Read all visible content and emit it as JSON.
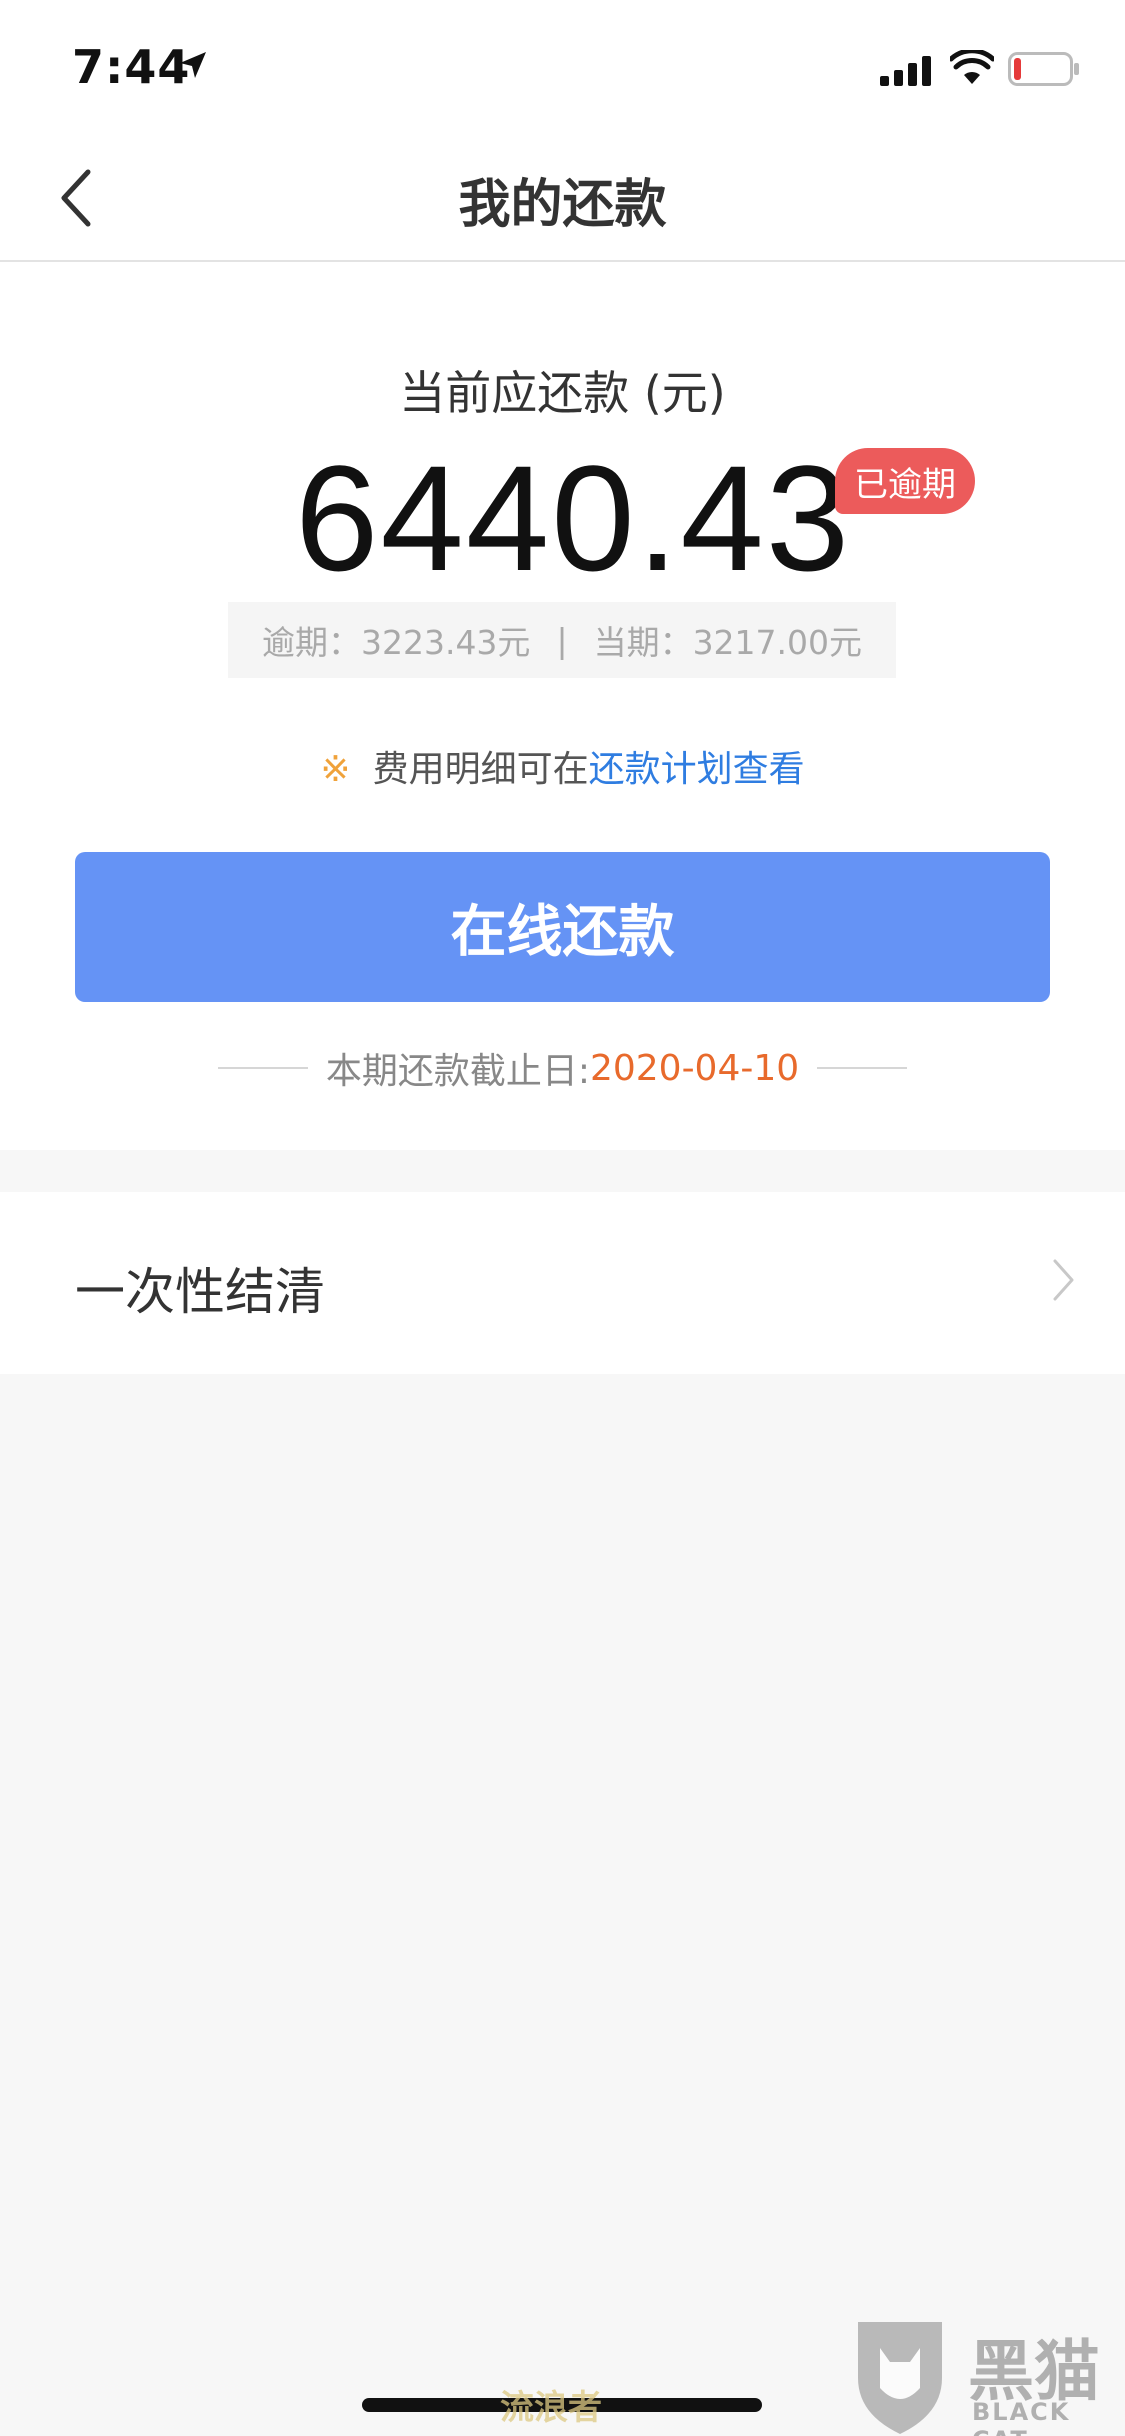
{
  "status_bar": {
    "time": "7:44"
  },
  "nav": {
    "title": "我的还款"
  },
  "summary": {
    "label": "当前应还款 (元)",
    "amount": "6440.43",
    "badge": "已逾期",
    "overdue_label": "逾期：",
    "overdue_amount": "3223.43元",
    "separator": "|",
    "current_label": "当期：",
    "current_amount": "3217.00元",
    "note_prefix": "费用明细可在",
    "note_link": "还款计划查看",
    "pay_button": "在线还款",
    "due_label": "本期还款截止日: ",
    "due_date": "2020-04-10"
  },
  "settle": {
    "label": "一次性结清"
  },
  "watermark": {
    "text": "流浪者",
    "logo_cn": "黑猫",
    "logo_en": "BLACK CAT"
  },
  "colors": {
    "primary_button": "#6593f5",
    "overdue_badge": "#ec5b5b",
    "link": "#2f7de1",
    "due_date": "#e86a2c",
    "note_icon": "#f0a23a"
  }
}
